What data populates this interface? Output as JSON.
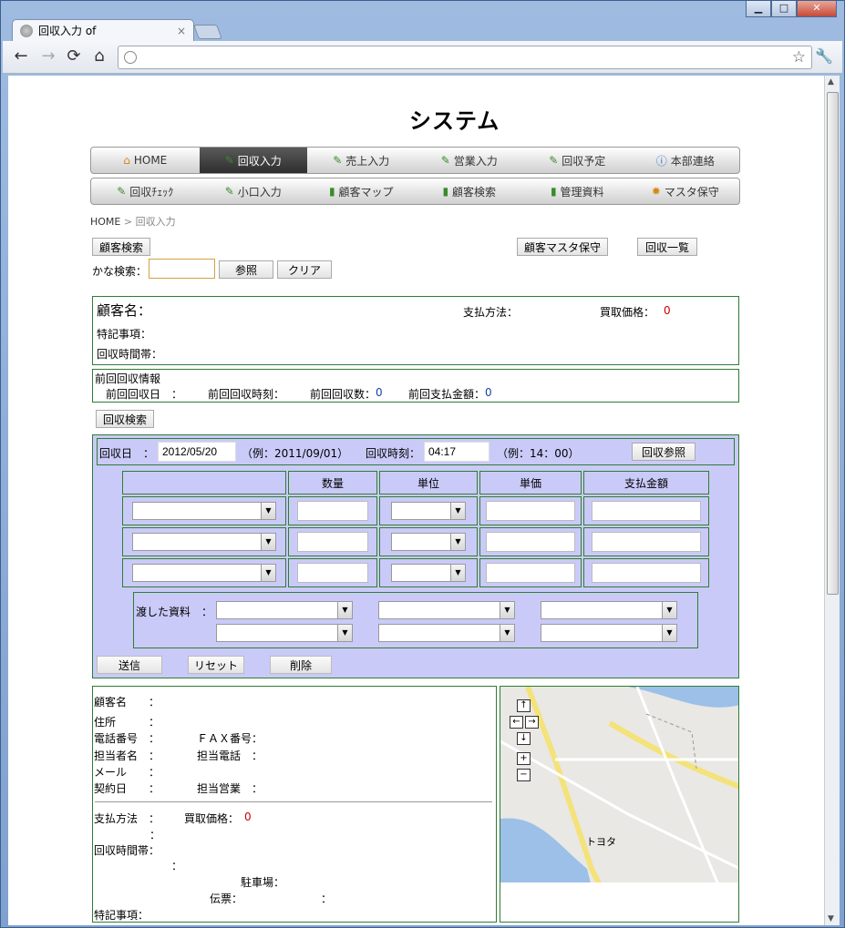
{
  "browser": {
    "tab_title": "回収入力 of",
    "tab_close": "×",
    "win_min": "▁",
    "win_max": "□",
    "win_close": "✕"
  },
  "header": {
    "logo_text": "システム"
  },
  "nav_row1": [
    {
      "label": "HOME"
    },
    {
      "label": "回収入力"
    },
    {
      "label": "売上入力"
    },
    {
      "label": "営業入力"
    },
    {
      "label": "回収予定"
    },
    {
      "label": "本部連絡"
    }
  ],
  "nav_row2": [
    {
      "label": "回収ﾁｪｯｸ"
    },
    {
      "label": "小口入力"
    },
    {
      "label": "顧客マップ"
    },
    {
      "label": "顧客検索"
    },
    {
      "label": "管理資料"
    },
    {
      "label": "マスタ保守"
    }
  ],
  "breadcrumb": {
    "home": "HOME",
    "sep": ">",
    "current": "回収入力"
  },
  "search": {
    "customer_search_btn": "顧客検索",
    "kana_label": "かな検索：",
    "kana_value": "",
    "ref_btn": "参照",
    "clear_btn": "クリア",
    "master_btn": "顧客マスタ保守",
    "list_btn": "回収一覧"
  },
  "customer": {
    "name_label": "顧客名：",
    "payment_label": "支払方法：",
    "price_label": "買取価格：",
    "price_value": "0",
    "notes_label": "特記事項：",
    "time_label": "回収時間帯："
  },
  "previous": {
    "title": "前回回収情報",
    "date_label": "前回回収日　：",
    "time_label": "前回回収時刻：",
    "count_label": "前回回収数：",
    "count_value": "0",
    "amount_label": "前回支払金額：",
    "amount_value": "0"
  },
  "collect_search_btn": "回収検索",
  "form": {
    "date_label": "回収日　：",
    "date_value": "2012/05/20",
    "date_example": "（例：2011/09/01）",
    "time_label": "回収時刻：",
    "time_value": "04:17",
    "time_example": "（例：14：00）",
    "ref_btn": "回収参照",
    "columns": [
      "数量",
      "単位",
      "単価",
      "支払金額"
    ],
    "docs_label": "渡した資料　：",
    "submit_btn": "送信",
    "reset_btn": "リセット",
    "delete_btn": "削除"
  },
  "details": {
    "name": "顧客名　　：",
    "address": "住所　　　：",
    "phone": "電話番号　：",
    "fax": "ＦＡＸ番号：",
    "contact": "担当者名　：",
    "contact_phone": "担当電話　：",
    "mail": "メール　　：",
    "contract": "契約日　　：",
    "sales": "担当営業　：",
    "pay": "支払方法　：",
    "price": "買取価格：",
    "price_value": "0",
    "colon": "：",
    "time": "回収時間帯：",
    "colon2": "：",
    "parking": "駐車場：",
    "slip": "伝票：",
    "colon3": "：",
    "notes": "特記事項："
  },
  "map": {
    "up": "↑",
    "left": "←",
    "right": "→",
    "down": "↓",
    "zoom_in": "+",
    "zoom_out": "−",
    "label": "トヨタ"
  }
}
